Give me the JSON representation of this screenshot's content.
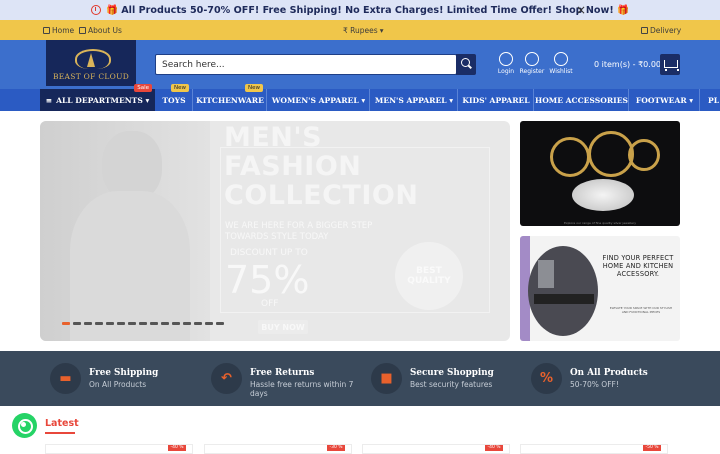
{
  "promo": {
    "text": "🎁 All Products 50-70% OFF! Free Shipping! No Extra Charges! Limited Time Offer! Shop Now! 🎁",
    "close": "×"
  },
  "topbar": {
    "home": "Home",
    "about": "About Us",
    "currency": "₹ Rupees",
    "delivery": "Delivery"
  },
  "header": {
    "logo_text": "BEAST OF CLOUD",
    "search_placeholder": "Search here...",
    "login": "Login",
    "register": "Register",
    "wishlist": "Wishlist",
    "cart": "0 item(s) - ₹0.00"
  },
  "nav": {
    "items": [
      {
        "label": "ALL DEPARTMENTS ▾",
        "badge": "Sale"
      },
      {
        "label": "TOYS",
        "badge": "New"
      },
      {
        "label": "KITCHENWARE",
        "badge": "New"
      },
      {
        "label": "WOMEN'S APPAREL ▾"
      },
      {
        "label": "MEN'S APPAREL ▾"
      },
      {
        "label": "KIDS' APPAREL"
      },
      {
        "label": "HOME ACCESSORIES"
      },
      {
        "label": "FOOTWEAR ▾"
      },
      {
        "label": "PL"
      }
    ]
  },
  "hero": {
    "title": "MEN'S\nFASHION\nCOLLECTION",
    "subtitle": "WE ARE HERE FOR A BIGGER STEP TOWARDS STYLE TODAY",
    "discount_label": "DISCOUNT UP TO",
    "percent": "75%",
    "off": "OFF",
    "badge": "BEST QUALITY",
    "button": "BUY NOW",
    "slides": 15,
    "active_slide": 0
  },
  "side_banner_1": {
    "caption": "Explore our range of fine quality silver jewellery"
  },
  "side_banner_2": {
    "headline": "FIND YOUR PERFECT HOME AND KITCHEN ACCESSORY.",
    "fine": "ELEVATE YOUR SPACE WITH OUR STYLISH AND FUNCTIONAL PIECES"
  },
  "features": [
    {
      "title": "Free Shipping",
      "sub": "On All Products",
      "icon": "truck-icon"
    },
    {
      "title": "Free Returns",
      "sub": "Hassle free returns within 7 days",
      "icon": "return-arrow-icon"
    },
    {
      "title": "Secure Shopping",
      "sub": "Best security features",
      "icon": "lock-icon"
    },
    {
      "title": "On All Products",
      "sub": "50-70% OFF!",
      "icon": "percent-icon"
    }
  ],
  "latest": {
    "heading": "Latest",
    "tags": [
      "-40 %",
      "-30 %",
      "-40 %",
      "-50 %"
    ]
  },
  "colors": {
    "accent": "#e8612c",
    "header": "#3c6fcc",
    "nav": "#2b5bc3",
    "navy": "#16275a",
    "yellow": "#f0c64a",
    "sale": "#e8473b",
    "features": "#3a4a5c"
  }
}
